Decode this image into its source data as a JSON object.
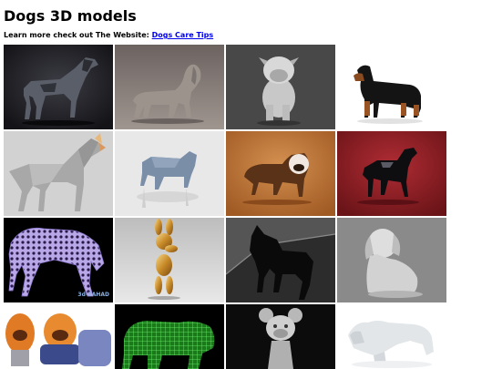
{
  "page": {
    "title": "Dogs 3D models",
    "intro_text": "Learn more check out The Website: ",
    "link_label": "Dogs Care Tips"
  },
  "gallery": {
    "items": [
      {
        "name": "dark-pointer-dog-model",
        "bg": "#1e1e22"
      },
      {
        "name": "grey-dachshund-model",
        "bg": "#8a807a"
      },
      {
        "name": "silver-bulldog-model",
        "bg": "#4a4a4a"
      },
      {
        "name": "black-tan-dachshund-model",
        "bg": "#ffffff"
      },
      {
        "name": "lowpoly-doberman-model",
        "bg": "#d4d4d4"
      },
      {
        "name": "blue-lowpoly-dog-model",
        "bg": "#e6e6e6"
      },
      {
        "name": "brown-bulldog-model",
        "bg": "#c07a3c"
      },
      {
        "name": "black-dog-on-red-model",
        "bg": "#9a2028"
      },
      {
        "name": "purple-wireframe-cheetah-model",
        "bg": "#000000",
        "credit": "3d-ZAHAD"
      },
      {
        "name": "gold-balloon-dog-model",
        "bg": "#cccccc"
      },
      {
        "name": "black-rottweiler-model",
        "bg": "#3a3a3a"
      },
      {
        "name": "grey-sitting-puppy-model",
        "bg": "#8c8c8c"
      },
      {
        "name": "orange-bulldog-figures-model",
        "bg": "#ffffff"
      },
      {
        "name": "green-wireframe-bulldog-model",
        "bg": "#000000"
      },
      {
        "name": "cartoon-dog-bust-model",
        "bg": "#0c0c0c"
      },
      {
        "name": "white-sculpted-dog-model",
        "bg": "#ffffff"
      }
    ]
  }
}
